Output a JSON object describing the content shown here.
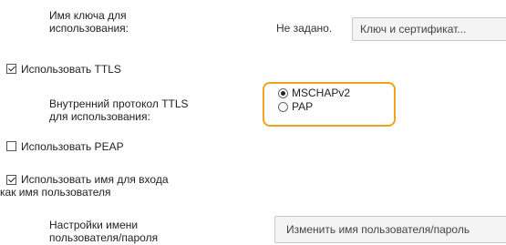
{
  "key_name": {
    "label_line1": "Имя ключа для",
    "label_line2": "использования:",
    "value": "Не задано.",
    "button_label": "Ключ и сертификат..."
  },
  "ttls": {
    "checkbox_label": "Использовать TTLS",
    "checked": true,
    "protocol_label_line1": "Внутренний протокол TTLS",
    "protocol_label_line2": "для использования:",
    "options": [
      {
        "label": "MSCHAPv2",
        "selected": true
      },
      {
        "label": "PAP",
        "selected": false
      }
    ],
    "highlight_color": "#f0a21d"
  },
  "peap": {
    "checkbox_label": "Использовать PEAP",
    "checked": false
  },
  "login_name": {
    "label_line1": "Использовать имя для входа",
    "label_line2": "как имя пользователя",
    "checked": true
  },
  "credentials": {
    "label_line1": "Настройки имени",
    "label_line2": "пользователя/пароля",
    "button_label": "Изменить имя пользователя/пароль"
  }
}
